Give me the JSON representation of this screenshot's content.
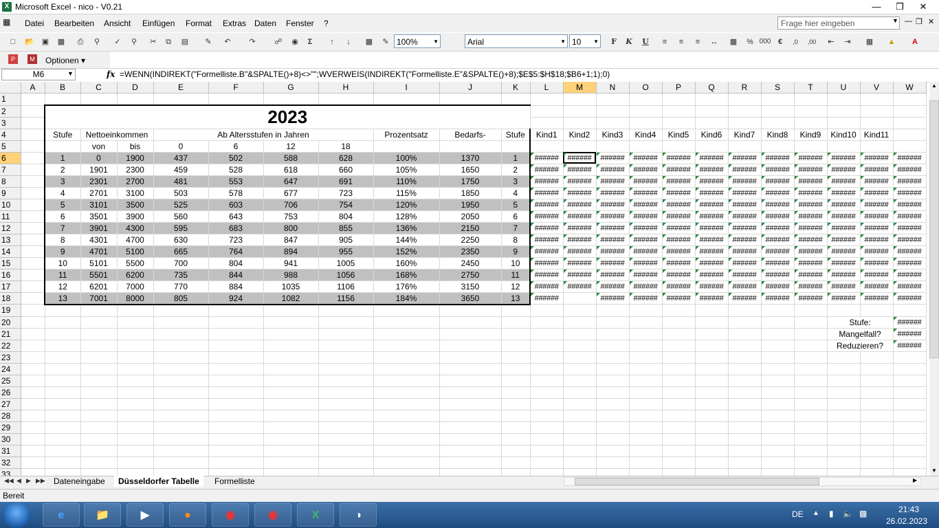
{
  "window": {
    "title": "Microsoft Excel - nico - V0.21",
    "icon": "excel-icon"
  },
  "menu": {
    "items": [
      "Datei",
      "Bearbeiten",
      "Ansicht",
      "Einfügen",
      "Format",
      "Extras",
      "Daten",
      "Fenster",
      "?"
    ],
    "ask_placeholder": "Frage hier eingeben"
  },
  "toolbar": {
    "zoom": "100%",
    "font": "Arial",
    "size": "10",
    "options_label": "Optionen"
  },
  "formula_bar": {
    "cell_ref": "M6",
    "fx": "fx",
    "formula": "=WENN(INDIREKT(\"Formelliste.B\"&SPALTE()+8)<>\"\";WVERWEIS(INDIREKT(\"Formelliste.E\"&SPALTE()+8);$E$5:$H$18;$B6+1;1);0)"
  },
  "sheet": {
    "columns": [
      "A",
      "B",
      "C",
      "D",
      "E",
      "F",
      "G",
      "H",
      "I",
      "J",
      "K",
      "L",
      "M",
      "N",
      "O",
      "P",
      "Q",
      "R",
      "S",
      "T",
      "U",
      "V",
      "W"
    ],
    "selected_column": "M",
    "selected_row": 6,
    "title": "2023",
    "headers": {
      "stufe": "Stufe",
      "netto": "Nettoeinkommen",
      "alter": "Ab Altersstufen in Jahren",
      "prozent": "Prozentsatz",
      "bedarf": "Bedarfs-",
      "stufe2": "Stufe",
      "kids": [
        "Kind1",
        "Kind2",
        "Kind3",
        "Kind4",
        "Kind5",
        "Kind6",
        "Kind7",
        "Kind8",
        "Kind9",
        "Kind10",
        "Kind11"
      ]
    },
    "subheaders": {
      "von": "von",
      "bis": "bis",
      "ages": [
        "0",
        "6",
        "12",
        "18"
      ]
    },
    "rows": [
      {
        "stufe": "1",
        "von": "0",
        "bis": "1900",
        "a0": "437",
        "a6": "502",
        "a12": "588",
        "a18": "628",
        "pct": "100%",
        "bedarf": "1370",
        "stufe2": "1"
      },
      {
        "stufe": "2",
        "von": "1901",
        "bis": "2300",
        "a0": "459",
        "a6": "528",
        "a12": "618",
        "a18": "660",
        "pct": "105%",
        "bedarf": "1650",
        "stufe2": "2"
      },
      {
        "stufe": "3",
        "von": "2301",
        "bis": "2700",
        "a0": "481",
        "a6": "553",
        "a12": "647",
        "a18": "691",
        "pct": "110%",
        "bedarf": "1750",
        "stufe2": "3"
      },
      {
        "stufe": "4",
        "von": "2701",
        "bis": "3100",
        "a0": "503",
        "a6": "578",
        "a12": "677",
        "a18": "723",
        "pct": "115%",
        "bedarf": "1850",
        "stufe2": "4"
      },
      {
        "stufe": "5",
        "von": "3101",
        "bis": "3500",
        "a0": "525",
        "a6": "603",
        "a12": "706",
        "a18": "754",
        "pct": "120%",
        "bedarf": "1950",
        "stufe2": "5"
      },
      {
        "stufe": "6",
        "von": "3501",
        "bis": "3900",
        "a0": "560",
        "a6": "643",
        "a12": "753",
        "a18": "804",
        "pct": "128%",
        "bedarf": "2050",
        "stufe2": "6"
      },
      {
        "stufe": "7",
        "von": "3901",
        "bis": "4300",
        "a0": "595",
        "a6": "683",
        "a12": "800",
        "a18": "855",
        "pct": "136%",
        "bedarf": "2150",
        "stufe2": "7"
      },
      {
        "stufe": "8",
        "von": "4301",
        "bis": "4700",
        "a0": "630",
        "a6": "723",
        "a12": "847",
        "a18": "905",
        "pct": "144%",
        "bedarf": "2250",
        "stufe2": "8"
      },
      {
        "stufe": "9",
        "von": "4701",
        "bis": "5100",
        "a0": "665",
        "a6": "764",
        "a12": "894",
        "a18": "955",
        "pct": "152%",
        "bedarf": "2350",
        "stufe2": "9"
      },
      {
        "stufe": "10",
        "von": "5101",
        "bis": "5500",
        "a0": "700",
        "a6": "804",
        "a12": "941",
        "a18": "1005",
        "pct": "160%",
        "bedarf": "2450",
        "stufe2": "10"
      },
      {
        "stufe": "11",
        "von": "5501",
        "bis": "6200",
        "a0": "735",
        "a6": "844",
        "a12": "988",
        "a18": "1056",
        "pct": "168%",
        "bedarf": "2750",
        "stufe2": "11"
      },
      {
        "stufe": "12",
        "von": "6201",
        "bis": "7000",
        "a0": "770",
        "a6": "884",
        "a12": "1035",
        "a18": "1106",
        "pct": "176%",
        "bedarf": "3150",
        "stufe2": "12"
      },
      {
        "stufe": "13",
        "von": "7001",
        "bis": "8000",
        "a0": "805",
        "a6": "924",
        "a12": "1082",
        "a18": "1156",
        "pct": "184%",
        "bedarf": "3650",
        "stufe2": "13"
      }
    ],
    "hash_value": "######",
    "side_labels": [
      "Stufe:",
      "Mangelfall?",
      "Reduzieren?"
    ]
  },
  "sheet_tabs": [
    "Dateneingabe",
    "Düsseldorfer Tabelle",
    "Formelliste"
  ],
  "active_tab": "Düsseldorfer Tabelle",
  "status": "Bereit",
  "taskbar": {
    "lang": "DE",
    "time": "21:43",
    "date": "26.02.2023"
  }
}
